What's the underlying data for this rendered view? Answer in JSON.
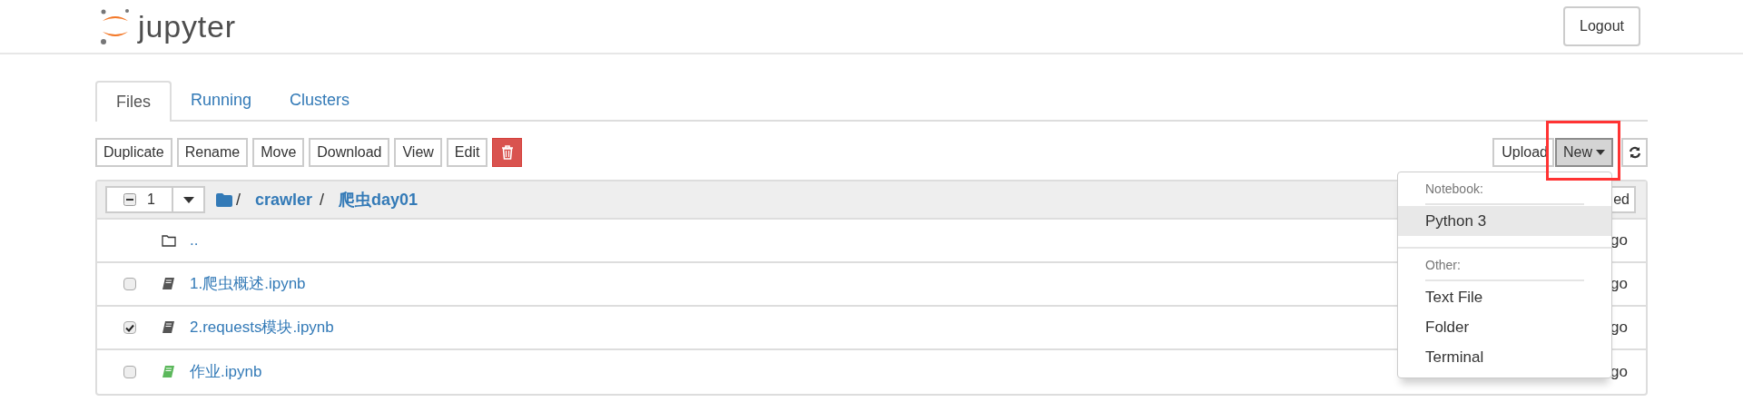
{
  "header": {
    "logo_text": "jupyter",
    "logout": "Logout"
  },
  "tabs": [
    {
      "label": "Files",
      "selected": true
    },
    {
      "label": "Running",
      "selected": false
    },
    {
      "label": "Clusters",
      "selected": false
    }
  ],
  "toolbar": {
    "buttons": [
      "Duplicate",
      "Rename",
      "Move",
      "Download",
      "View",
      "Edit"
    ],
    "upload": "Upload",
    "new": "New"
  },
  "list_header": {
    "indeterminate": true,
    "selected_count": "1",
    "breadcrumb": [
      {
        "label": "crawler"
      },
      {
        "label": "爬虫day01"
      }
    ],
    "separator": "/",
    "sort_button": "ed"
  },
  "rows": [
    {
      "kind": "parent",
      "name": "..",
      "modified": "go"
    },
    {
      "kind": "notebook",
      "name": "1.爬虫概述.ipynb",
      "checked": false,
      "running": false,
      "modified": "go"
    },
    {
      "kind": "notebook",
      "name": "2.requests模块.ipynb",
      "checked": true,
      "running": false,
      "modified": "go"
    },
    {
      "kind": "notebook",
      "name": "作业.ipynb",
      "checked": false,
      "running": true,
      "modified": "go"
    }
  ],
  "new_menu": {
    "sections": [
      {
        "heading": "Notebook:",
        "items": [
          {
            "label": "Python 3",
            "selected": true
          }
        ]
      },
      {
        "heading": "Other:",
        "items": [
          {
            "label": "Text File",
            "selected": false
          },
          {
            "label": "Folder",
            "selected": false
          },
          {
            "label": "Terminal",
            "selected": false
          }
        ]
      }
    ]
  },
  "highlight": {
    "on": true
  }
}
